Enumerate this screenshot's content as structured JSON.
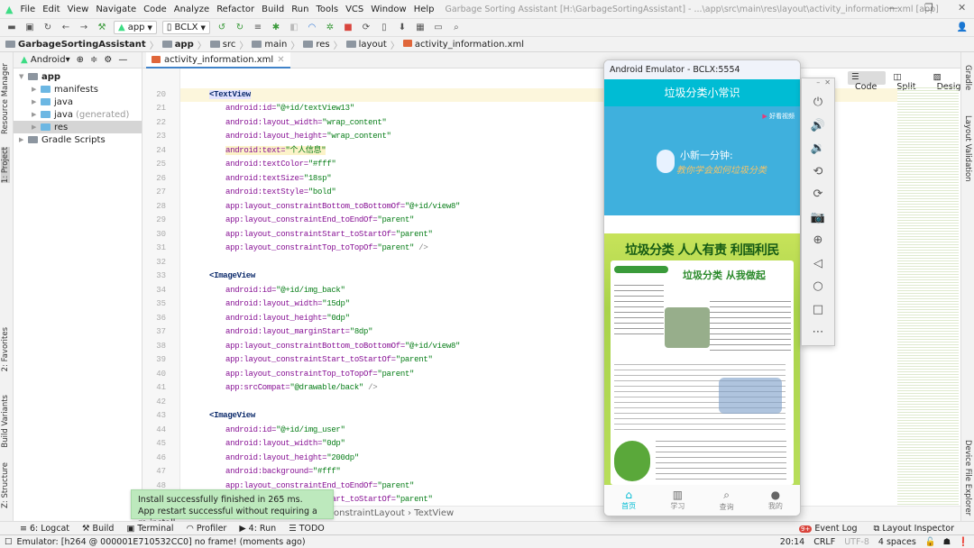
{
  "menu": {
    "items": [
      "File",
      "Edit",
      "View",
      "Navigate",
      "Code",
      "Analyze",
      "Refactor",
      "Build",
      "Run",
      "Tools",
      "VCS",
      "Window",
      "Help"
    ],
    "title": "Garbage Sorting Assistant [H:\\GarbageSortingAssistant] - ...\\app\\src\\main\\res\\layout\\activity_information.xml [app]"
  },
  "toolbar": {
    "module": "app",
    "device": "BCLX"
  },
  "breadcrumb": [
    "GarbageSortingAssistant",
    "app",
    "src",
    "main",
    "res",
    "layout",
    "activity_information.xml"
  ],
  "left_strip": [
    "Resource Manager",
    "1: Project",
    "2: Favorites",
    "Build Variants",
    "Z: Structure"
  ],
  "project": {
    "view": "Android",
    "tree": [
      {
        "label": "app",
        "depth": 0,
        "bold": true
      },
      {
        "label": "manifests",
        "depth": 1
      },
      {
        "label": "java",
        "depth": 1
      },
      {
        "label": "java",
        "extra": "(generated)",
        "depth": 1
      },
      {
        "label": "res",
        "depth": 1,
        "selected": true
      },
      {
        "label": "Gradle Scripts",
        "depth": 0
      }
    ]
  },
  "editor": {
    "tab": "activity_information.xml",
    "view_modes": [
      "Code",
      "Split",
      "Design"
    ],
    "crumb": [
      "ConstraintLayout",
      "TextView"
    ],
    "lines": [
      {
        "n": "20",
        "tag": "<TextView"
      },
      {
        "n": "21",
        "attr": "android:id=",
        "val": "\"@+id/textView13\""
      },
      {
        "n": "22",
        "attr": "android:layout_width=",
        "val": "\"wrap_content\""
      },
      {
        "n": "23",
        "attr": "android:layout_height=",
        "val": "\"wrap_content\""
      },
      {
        "n": "24",
        "attr": "android:text=",
        "val": "\"个人信息\"",
        "hl": true
      },
      {
        "n": "25",
        "attr": "android:textColor=",
        "val": "\"#fff\""
      },
      {
        "n": "26",
        "attr": "android:textSize=",
        "val": "\"18sp\""
      },
      {
        "n": "27",
        "attr": "android:textStyle=",
        "val": "\"bold\""
      },
      {
        "n": "28",
        "attr": "app:layout_constraintBottom_toBottomOf=",
        "val": "\"@+id/view8\""
      },
      {
        "n": "29",
        "attr": "app:layout_constraintEnd_toEndOf=",
        "val": "\"parent\""
      },
      {
        "n": "30",
        "attr": "app:layout_constraintStart_toStartOf=",
        "val": "\"parent\""
      },
      {
        "n": "31",
        "attr": "app:layout_constraintTop_toTopOf=",
        "val": "\"parent\"",
        "end": " />"
      },
      {
        "n": "32"
      },
      {
        "n": "33",
        "tag": "<ImageView"
      },
      {
        "n": "34",
        "attr": "android:id=",
        "val": "\"@+id/img_back\""
      },
      {
        "n": "35",
        "attr": "android:layout_width=",
        "val": "\"15dp\""
      },
      {
        "n": "36",
        "attr": "android:layout_height=",
        "val": "\"0dp\""
      },
      {
        "n": "37",
        "attr": "android:layout_marginStart=",
        "val": "\"8dp\""
      },
      {
        "n": "38",
        "attr": "app:layout_constraintBottom_toBottomOf=",
        "val": "\"@+id/view8\""
      },
      {
        "n": "39",
        "attr": "app:layout_constraintStart_toStartOf=",
        "val": "\"parent\""
      },
      {
        "n": "40",
        "attr": "app:layout_constraintTop_toTopOf=",
        "val": "\"parent\""
      },
      {
        "n": "41",
        "attr": "app:srcCompat=",
        "val": "\"@drawable/back\"",
        "end": " />"
      },
      {
        "n": "42"
      },
      {
        "n": "43",
        "tag": "<ImageView"
      },
      {
        "n": "44",
        "attr": "android:id=",
        "val": "\"@+id/img_user\""
      },
      {
        "n": "45",
        "attr": "android:layout_width=",
        "val": "\"0dp\""
      },
      {
        "n": "46",
        "attr": "android:layout_height=",
        "val": "\"200dp\""
      },
      {
        "n": "47",
        "attr": "android:background=",
        "val": "\"#fff\""
      },
      {
        "n": "48",
        "attr": "app:layout_constraintEnd_toEndOf=",
        "val": "\"parent\""
      },
      {
        "n": "49",
        "attr": "app:layout_constraintStart_toStartOf=",
        "val": "\"parent\""
      }
    ]
  },
  "right_strip": [
    "Gradle",
    "Layout Validation",
    "Device File Explorer"
  ],
  "emulator": {
    "title": "Android Emulator - BCLX:5554",
    "app_title": "垃圾分类小常识",
    "video_brand": "好看视频",
    "video_line1": "小新一分钟:",
    "video_line2": "教你学会如何垃圾分类",
    "poster_banner": "垃圾分类 人人有责 利国利民",
    "poster_heading": "垃圾分类 从我做起",
    "nav": [
      {
        "label": "首页",
        "icon": "home-icon",
        "active": true
      },
      {
        "label": "学习",
        "icon": "book-icon"
      },
      {
        "label": "查询",
        "icon": "search-icon"
      },
      {
        "label": "我的",
        "icon": "profile-icon"
      }
    ],
    "accent": "#00bcd4"
  },
  "emulator_side": [
    "power-icon",
    "volume-up-icon",
    "volume-down-icon",
    "rotate-left-icon",
    "rotate-right-icon",
    "camera-icon",
    "zoom-icon",
    "back-icon",
    "home-icon",
    "overview-icon",
    "more-icon"
  ],
  "toast": {
    "line1": "Install successfully finished in 265 ms.",
    "line2": "App restart successful without requiring a re-install."
  },
  "toolwindows": [
    "6: Logcat",
    "Build",
    "Terminal",
    "Profiler",
    "4: Run",
    "TODO"
  ],
  "toolwindows_right": {
    "event_log": "Event Log",
    "event_badge": "9+",
    "layout_inspector": "Layout Inspector"
  },
  "status": {
    "message": "Emulator: [h264 @ 000001E710532CC0] no frame! (moments ago)",
    "position": "20:14",
    "line_sep": "CRLF",
    "encoding": "UTF-8",
    "indent": "4 spaces"
  }
}
